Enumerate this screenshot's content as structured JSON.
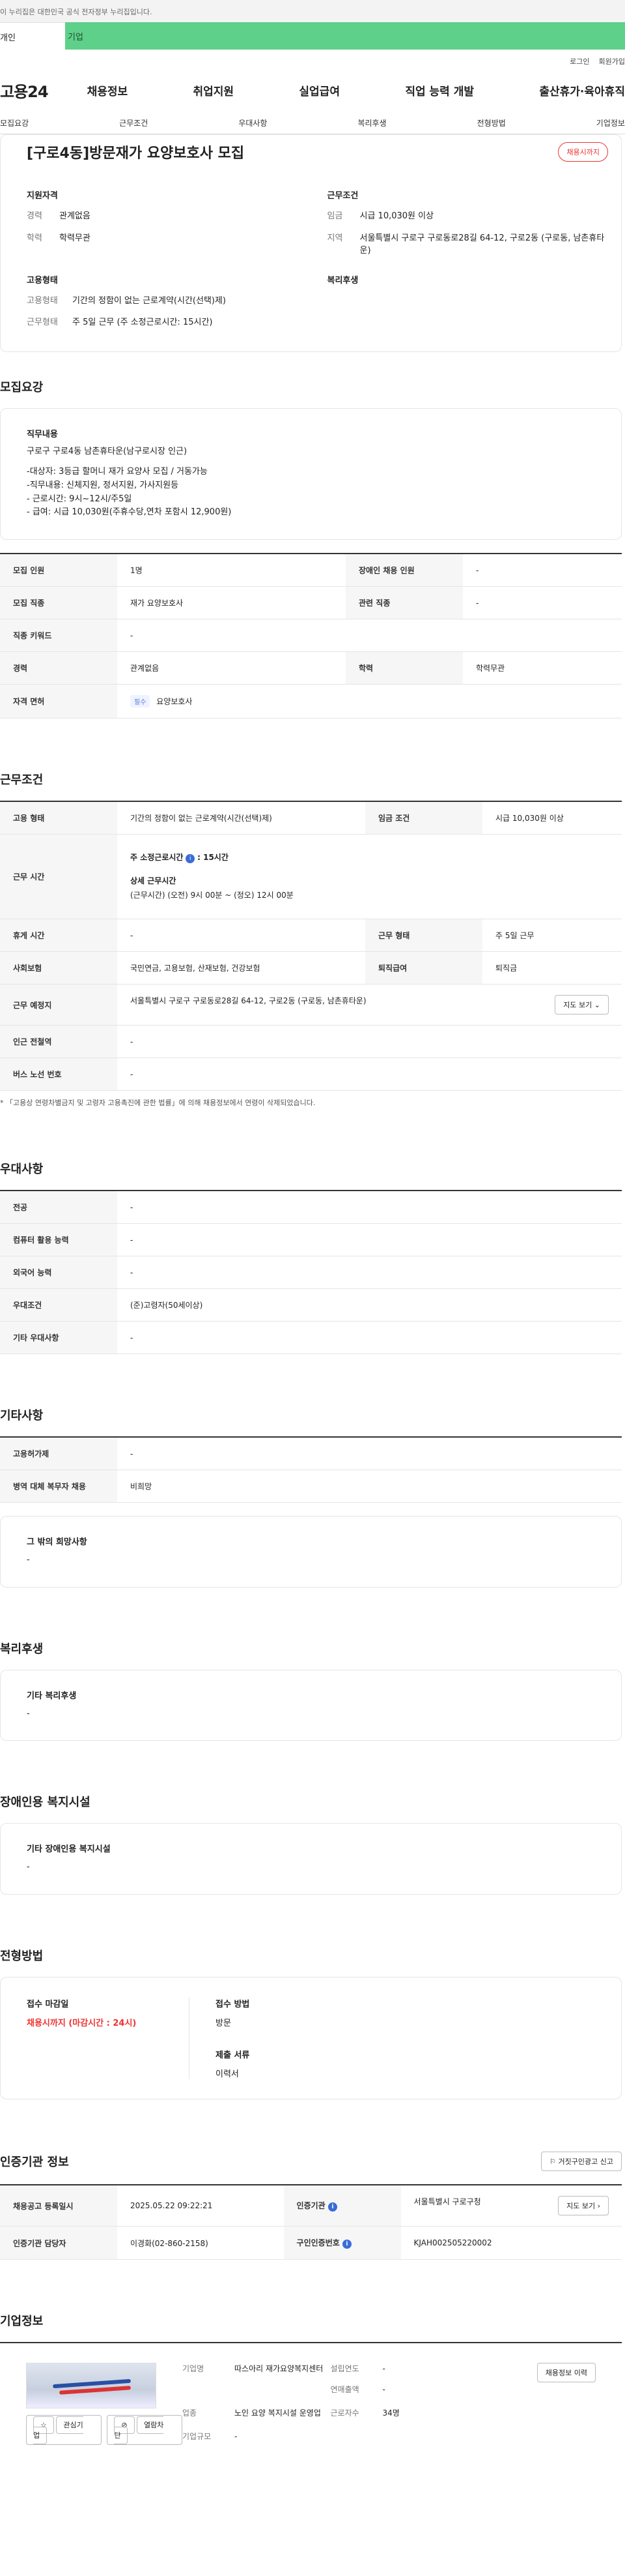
{
  "gov_banner": "이 누리집은 대한민국 공식 전자정부 누리집입니다.",
  "top_tabs": [
    "개인",
    "기업"
  ],
  "util": {
    "login": "로그인",
    "join": "회원가입"
  },
  "logo": "고용24",
  "gnb": [
    "채용정보",
    "취업지원",
    "실업급여",
    "직업 능력 개발",
    "출산휴가·육아휴직"
  ],
  "sub_nav": [
    "모집요강",
    "근무조건",
    "우대사항",
    "복리후생",
    "전형방법",
    "기업정보"
  ],
  "hero": {
    "title": "[구로4동]방문재가 요양보호사 모집",
    "badge": "채용시까지",
    "qual_title": "지원자격",
    "career_k": "경력",
    "career_v": "관계없음",
    "edu_k": "학력",
    "edu_v": "학력무관",
    "emp_title": "고용형태",
    "emptype_k": "고용형태",
    "emptype_v": "기간의 정함이 없는 근로계약(시간(선택)제)",
    "worktype_k": "근무형태",
    "worktype_v": "주 5일 근무 (주 소정근로시간: 15시간)",
    "cond_title": "근무조건",
    "wage_k": "임금",
    "wage_v": "시급 10,030원 이상",
    "area_k": "지역",
    "area_v": "서울특별시 구로구 구로동로28길 64-12, 구로2동 (구로동, 남촌휴타운)",
    "welfare_title": "복리후생"
  },
  "recruit": {
    "title": "모집요강",
    "duty_title": "직무내용",
    "duty_lines": [
      "구로구 구로4동 남촌휴타운(남구로시장 인근)",
      "",
      "-대상자: 3등급 할머니 재가 요양사 모집 / 거동가능",
      "-직무내용: 신체지원, 정서지원, 가사지원등",
      "- 근로시간: 9시~12시/주5일",
      "- 급여:  시급 10,030원(주휴수당,연차 포함시  12,900원)"
    ],
    "rows": {
      "count_k": "모집 인원",
      "count_v": "1명",
      "disabled_k": "장애인 채용 인원",
      "disabled_v": "-",
      "job_k": "모집 직종",
      "job_v": "재가 요양보호사",
      "rel_k": "관련 직종",
      "rel_v": "-",
      "kw_k": "직종 키워드",
      "kw_v": "-",
      "career_k": "경력",
      "career_v": "관계없음",
      "edu_k": "학력",
      "edu_v": "학력무관",
      "lic_k": "자격 면허",
      "lic_tag": "필수",
      "lic_v": "요양보호사"
    }
  },
  "work": {
    "title": "근무조건",
    "emptype_k": "고용 형태",
    "emptype_v": "기간의 정함이 없는 근로계약(시간(선택)제)",
    "wage_k": "임금 조건",
    "wage_v": "시급 10,030원 이상",
    "hours_k": "근무 시간",
    "hours_line1": "주 소정근로시간",
    "hours_line1_v": ": 15시간",
    "hours_detail_t": "상세 근무시간",
    "hours_detail_v": "(근무시간) (오전) 9시 00분 ~ (정오) 12시 00분",
    "rest_k": "휴게 시간",
    "rest_v": "-",
    "form_k": "근무 형태",
    "form_v": "주 5일 근무",
    "ins_k": "사회보험",
    "ins_v": "국민연금, 고용보험, 산재보험, 건강보험",
    "ret_k": "퇴직급여",
    "ret_v": "퇴직금",
    "place_k": "근무 예정지",
    "place_v": "서울특별시 구로구 구로동로28길 64-12, 구로2동 (구로동, 남촌휴타운)",
    "map_btn": "지도 보기",
    "sub_k": "인근 전철역",
    "sub_v": "-",
    "bus_k": "버스 노선 번호",
    "bus_v": "-",
    "note": "* 「고용상 연령차별금지 및 고령자 고용촉진에 관한 법률」에 의해 채용정보에서 연령이 삭제되었습니다."
  },
  "pref": {
    "title": "우대사항",
    "major_k": "전공",
    "major_v": "-",
    "pc_k": "컴퓨터 활용 능력",
    "pc_v": "-",
    "lang_k": "외국어 능력",
    "lang_v": "-",
    "cond_k": "우대조건",
    "cond_v": "(준)고령자(50세이상)",
    "etc_k": "기타 우대사항",
    "etc_v": "-"
  },
  "other": {
    "title": "기타사항",
    "ins_k": "고용허가제",
    "ins_v": "-",
    "mil_k": "병역 대체 복무자 채용",
    "mil_v": "비희망",
    "wish_t": "그 밖의 희망사항",
    "wish_v": "-"
  },
  "welfare": {
    "title": "복리후생",
    "box_t": "기타 복리후생",
    "box_v": "-"
  },
  "disabled": {
    "title": "장애인용 복지시설",
    "box_t": "기타 장애인용 복지시설",
    "box_v": "-"
  },
  "process": {
    "title": "전형방법",
    "deadline_t": "접수 마감일",
    "deadline_v": "채용시까지 (마감시간 : 24시)",
    "method_t": "접수 방법",
    "method_v": "방문",
    "docs_t": "제출 서류",
    "docs_v": "이력서"
  },
  "auth": {
    "title": "인증기관 정보",
    "report_btn": "거짓구인광고 신고",
    "reg_k": "채용공고 등록일시",
    "reg_v": "2025.05.22 09:22:21",
    "org_k": "인증기관",
    "org_v": "서울특별시 구로구청",
    "map_btn": "지도 보기",
    "mgr_k": "인증기관 담당자",
    "mgr_v": "이경화(02-860-2158)",
    "no_k": "구인인증번호",
    "no_v": "KJAH002505220002"
  },
  "company": {
    "title": "기업정보",
    "fav": "관심기업",
    "block": "열람차단",
    "name_k": "기업명",
    "name_v": "따스아리 재가요양복지센터",
    "year_k": "설립연도",
    "year_v": "-",
    "sales_k": "연매출액",
    "sales_v": "-",
    "ind_k": "업종",
    "ind_v": "노인 요양 복지시설 운영업",
    "emp_k": "근로자수",
    "emp_v": "34명",
    "size_k": "기업규모",
    "size_v": "-",
    "hist_btn": "채용정보 이력"
  }
}
